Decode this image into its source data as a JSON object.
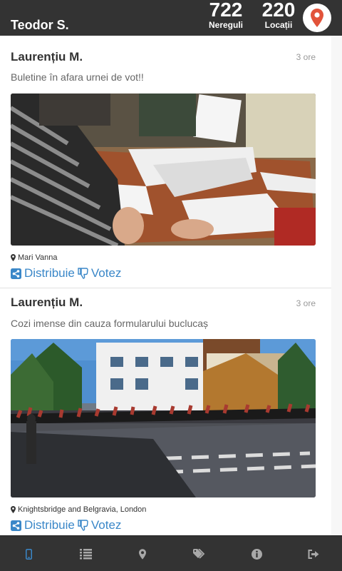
{
  "header": {
    "user_name": "Teodor S.",
    "stats": {
      "nereguli_count": "722",
      "nereguli_label": "Nereguli",
      "locatii_count": "220",
      "locatii_label": "Locații"
    },
    "location_button_icon": "map-marker-icon",
    "accent_color": "#e2533a"
  },
  "feed": {
    "posts": [
      {
        "author": "Laurențiu M.",
        "time": "3 ore",
        "text": "Buletine în afara urnei de vot!!",
        "location": "Mari Vanna",
        "share_label": "Distribuie",
        "vote_label": "Votez"
      },
      {
        "author": "Laurențiu M.",
        "time": "3 ore",
        "text": "Cozi imense din cauza formularului buclucaș",
        "location": "Knightsbridge and Belgravia, London",
        "share_label": "Distribuie",
        "vote_label": "Votez"
      }
    ],
    "link_color": "#3a87c8"
  },
  "nav": {
    "items": [
      {
        "icon": "mobile-icon",
        "active": true
      },
      {
        "icon": "list-icon"
      },
      {
        "icon": "map-marker-icon"
      },
      {
        "icon": "tags-icon"
      },
      {
        "icon": "info-icon"
      },
      {
        "icon": "sign-out-icon"
      }
    ],
    "active_color": "#3a87c8",
    "inactive_color": "#a8a8a8"
  }
}
